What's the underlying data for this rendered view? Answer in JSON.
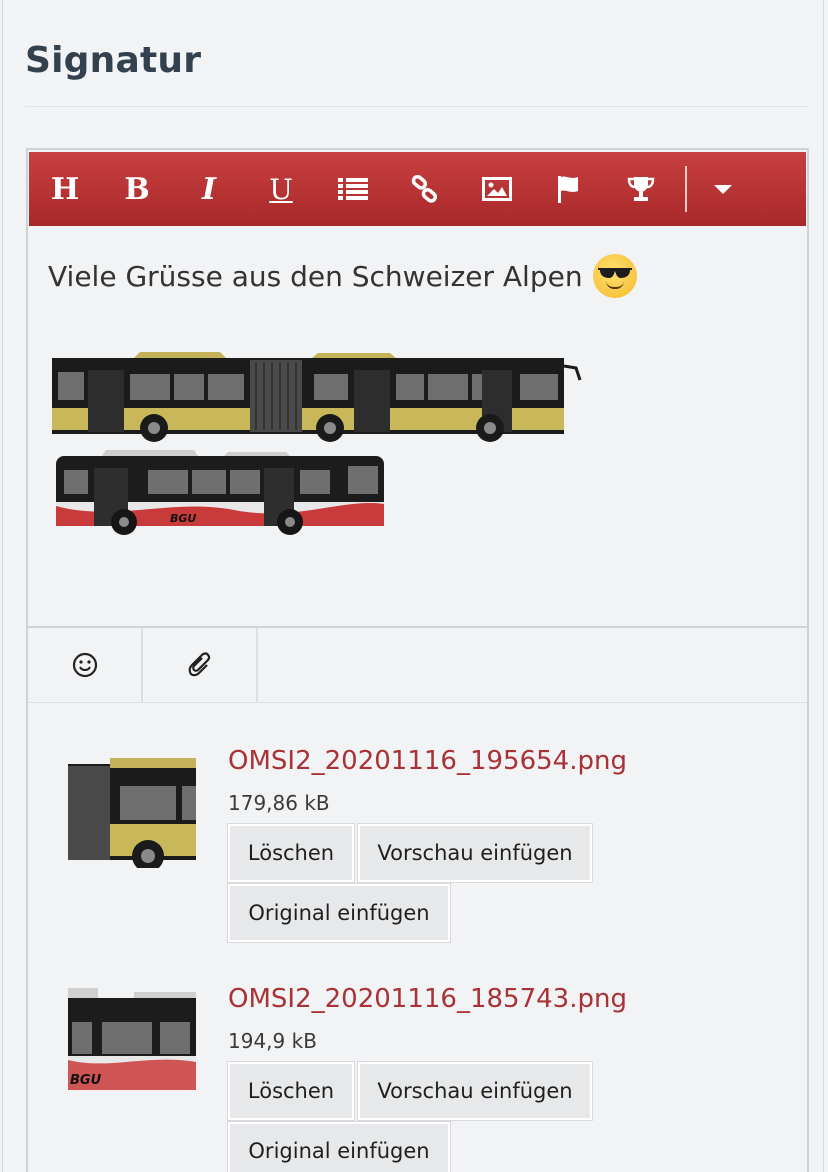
{
  "page": {
    "title": "Signatur"
  },
  "toolbar": {
    "heading_label": "H",
    "bold_label": "B",
    "italic_label": "I",
    "underline_label": "U",
    "icons": [
      "list-icon",
      "link-icon",
      "image-icon",
      "flag-icon",
      "trophy-icon",
      "caret-down-icon"
    ]
  },
  "editor": {
    "signature_text": "Viele Grüsse aus den Schweizer Alpen",
    "emoji": "smiling-face-with-sunglasses"
  },
  "subbar": {
    "icons": [
      "smiley-icon",
      "paperclip-icon"
    ]
  },
  "attachments": [
    {
      "filename": "OMSI2_20201116_195654.png",
      "size": "179,86 kB",
      "delete_label": "Löschen",
      "insert_preview_label": "Vorschau einfügen",
      "insert_original_label": "Original einfügen"
    },
    {
      "filename": "OMSI2_20201116_185743.png",
      "size": "194,9 kB",
      "delete_label": "Löschen",
      "insert_preview_label": "Vorschau einfügen",
      "insert_original_label": "Original einfügen"
    }
  ],
  "colors": {
    "toolbar_red": "#b8302f",
    "link_red": "#a93236",
    "title_slate": "#33414f",
    "bus_yellow": "#c9b85a",
    "bus_red": "#c93b3a"
  }
}
